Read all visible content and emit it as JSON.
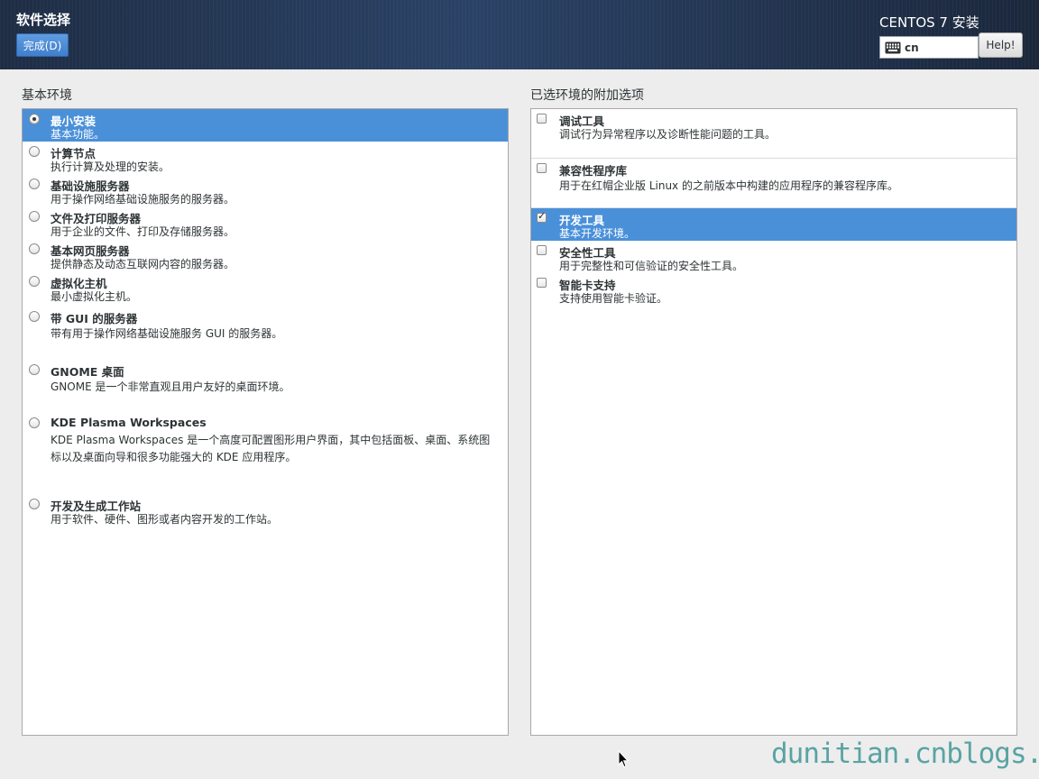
{
  "header": {
    "title": "软件选择",
    "done_label": "完成(D)",
    "product_title": "CENTOS 7 安装",
    "keyboard_layout": "cn",
    "help_label": "Help!"
  },
  "left": {
    "title": "基本环境",
    "environments": [
      {
        "name": "最小安装",
        "desc": "基本功能。",
        "selected": true
      },
      {
        "name": "计算节点",
        "desc": "执行计算及处理的安装。",
        "selected": false
      },
      {
        "name": "基础设施服务器",
        "desc": "用于操作网络基础设施服务的服务器。",
        "selected": false
      },
      {
        "name": "文件及打印服务器",
        "desc": "用于企业的文件、打印及存储服务器。",
        "selected": false
      },
      {
        "name": "基本网页服务器",
        "desc": "提供静态及动态互联网内容的服务器。",
        "selected": false
      },
      {
        "name": "虚拟化主机",
        "desc": "最小虚拟化主机。",
        "selected": false
      },
      {
        "name": "带 GUI 的服务器",
        "desc": "带有用于操作网络基础设施服务 GUI 的服务器。",
        "selected": false
      },
      {
        "name": "GNOME 桌面",
        "desc": "GNOME 是一个非常直观且用户友好的桌面环境。",
        "selected": false
      },
      {
        "name": "KDE Plasma Workspaces",
        "desc": "KDE Plasma Workspaces 是一个高度可配置图形用户界面，其中包括面板、桌面、系统图标以及桌面向导和很多功能强大的 KDE 应用程序。",
        "selected": false
      },
      {
        "name": "开发及生成工作站",
        "desc": "用于软件、硬件、图形或者内容开发的工作站。",
        "selected": false
      }
    ]
  },
  "right": {
    "title": "已选环境的附加选项",
    "addons": [
      {
        "name": "调试工具",
        "desc": "调试行为异常程序以及诊断性能问题的工具。",
        "checked": false,
        "highlighted": false
      },
      {
        "name": "兼容性程序库",
        "desc": "用于在红帽企业版 Linux 的之前版本中构建的应用程序的兼容程序库。",
        "checked": false,
        "highlighted": false
      },
      {
        "name": "开发工具",
        "desc": "基本开发环境。",
        "checked": true,
        "highlighted": true
      },
      {
        "name": "安全性工具",
        "desc": "用于完整性和可信验证的安全性工具。",
        "checked": false,
        "highlighted": false
      },
      {
        "name": "智能卡支持",
        "desc": "支持使用智能卡验证。",
        "checked": false,
        "highlighted": false
      }
    ]
  },
  "watermark": "dunitian.cnblogs.com",
  "colors": {
    "accent": "#4a90d9",
    "header": "#243957",
    "watermark": "#5aa3a3"
  },
  "icons": {
    "keyboard": "keyboard-icon",
    "cursor": "mouse-cursor-icon"
  }
}
